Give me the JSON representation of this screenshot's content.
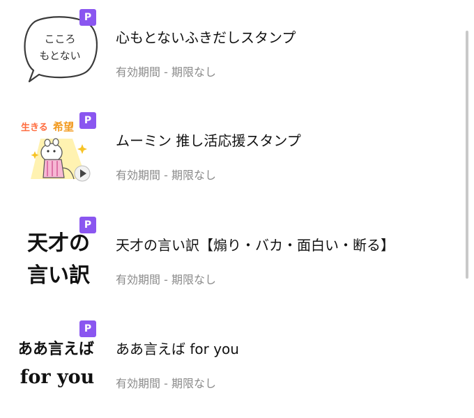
{
  "badge_label": "P",
  "items": [
    {
      "title": "心もとないふきだしスタンプ",
      "validity": "有効期間 - 期限なし",
      "thumb_text": [
        "こころ",
        "もとない"
      ]
    },
    {
      "title": "ムーミン 推し活応援スタンプ",
      "validity": "有効期間 - 期限なし",
      "thumb_text": [
        "生きる",
        "希望"
      ]
    },
    {
      "title": "天才の言い訳【煽り・バカ・面白い・断る】",
      "validity": "有効期間 - 期限なし",
      "thumb_text": [
        "天才の",
        "言い訳"
      ]
    },
    {
      "title": "ああ言えば for you",
      "validity": "有効期間 - 期限なし",
      "thumb_text": [
        "ああ言えば",
        "for you"
      ]
    }
  ],
  "colors": {
    "badge": "#8a56f0",
    "title": "#111111",
    "subtext": "#8a8a8a",
    "thumb_orange": "#ff6b3d",
    "thumb_yellow": "#f7c325"
  }
}
